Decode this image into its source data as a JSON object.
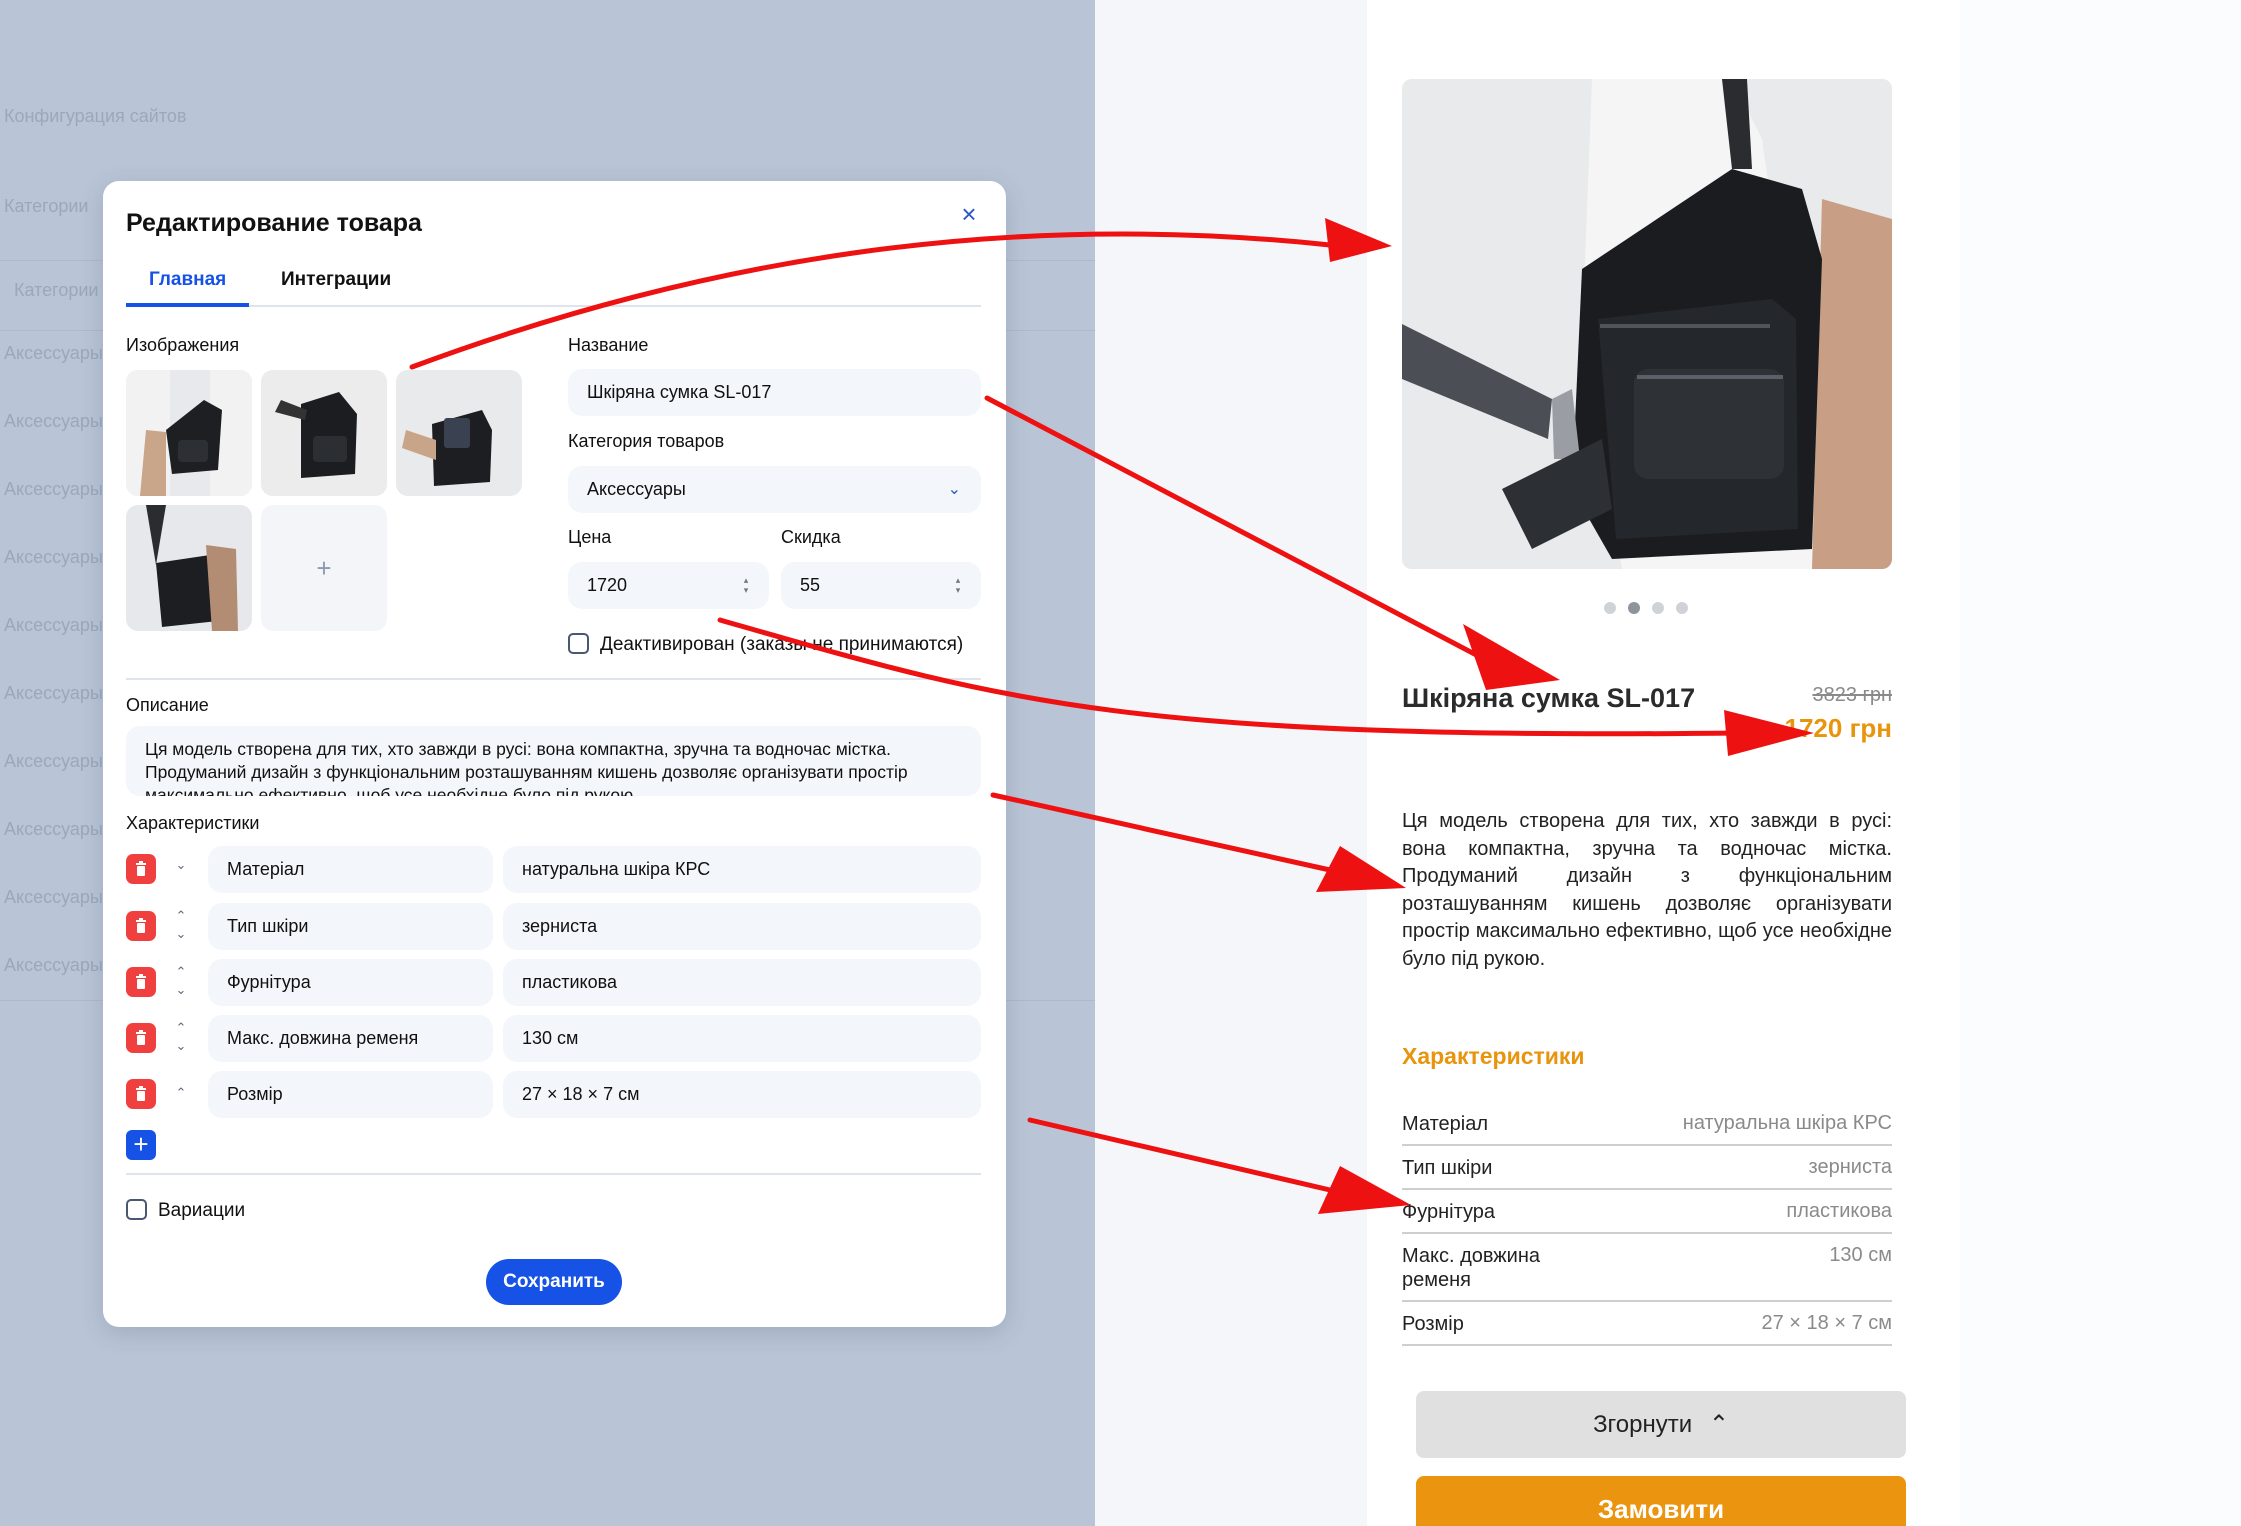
{
  "admin_background": {
    "sidebar_heading": "Конфигурация сайтов",
    "rows": [
      "Категории",
      "Категории",
      "Аксессуары",
      "Аксессуары",
      "Аксессуары",
      "Аксессуары",
      "Аксессуары",
      "Аксессуары",
      "Аксессуары",
      "Аксессуары",
      "Аксессуары",
      "Аксессуары"
    ]
  },
  "modal": {
    "title": "Редактирование товара",
    "close_icon": "close-icon",
    "tabs": [
      {
        "label": "Главная",
        "active": true
      },
      {
        "label": "Интеграции",
        "active": false
      }
    ],
    "images_label": "Изображения",
    "add_image": "+",
    "name_label": "Название",
    "name_value": "Шкіряна сумка SL-017",
    "category_label": "Категория товаров",
    "category_value": "Аксессуары",
    "price_label": "Цена",
    "price_value": "1720",
    "discount_label": "Скидка",
    "discount_value": "55",
    "deactivated_label": "Деактивирован (заказы не принимаются)",
    "deactivated_checked": false,
    "description_label": "Описание",
    "description_value": "Ця модель створена для тих, хто завжди в русі: вона компактна, зручна та водночас містка. Продуманий дизайн з функціональним розташуванням кишень дозволяє організувати простір максимально ефективно, щоб усе необхідне було під рукою.",
    "specs_label": "Характеристики",
    "specs": [
      {
        "key": "Матеріал",
        "value": "натуральна шкіра КРС"
      },
      {
        "key": "Тип шкіри",
        "value": "зерниста"
      },
      {
        "key": "Фурнітура",
        "value": "пластикова"
      },
      {
        "key": "Макс. довжина ременя",
        "value": "130 см"
      },
      {
        "key": "Розмір",
        "value": "27 × 18 × 7 см"
      }
    ],
    "add_spec": "+",
    "variations_label": "Вариации",
    "variations_checked": false,
    "save_label": "Сохранить"
  },
  "preview": {
    "title": "Шкіряна сумка SL-017",
    "old_price": "3823 грн",
    "new_price": "1720 грн",
    "description": "Ця модель створена для тих, хто завжди в русі: вона компактна, зручна та водночас містка. Продуманий дизайн з функціональним розташуванням кишень дозволяє організувати простір максимально ефективно, щоб усе необхідне було під рукою.",
    "specs_title": "Характеристики",
    "specs": [
      {
        "key": "Матеріал",
        "value": "натуральна шкіра КРС"
      },
      {
        "key": "Тип шкіри",
        "value": "зерниста"
      },
      {
        "key": "Фурнітура",
        "value": "пластикова"
      },
      {
        "key": "Макс. довжина ременя",
        "value": "130 см"
      },
      {
        "key": "Розмір",
        "value": "27 × 18 × 7 см"
      }
    ],
    "carousel_active_index": 1,
    "carousel_count": 4,
    "collapse_label": "Згорнути",
    "order_label": "Замовити"
  },
  "colors": {
    "accent_blue": "#1652e6",
    "danger_red": "#ef3f3f",
    "price_orange": "#e8940d",
    "arrow_red": "#ee1111"
  }
}
